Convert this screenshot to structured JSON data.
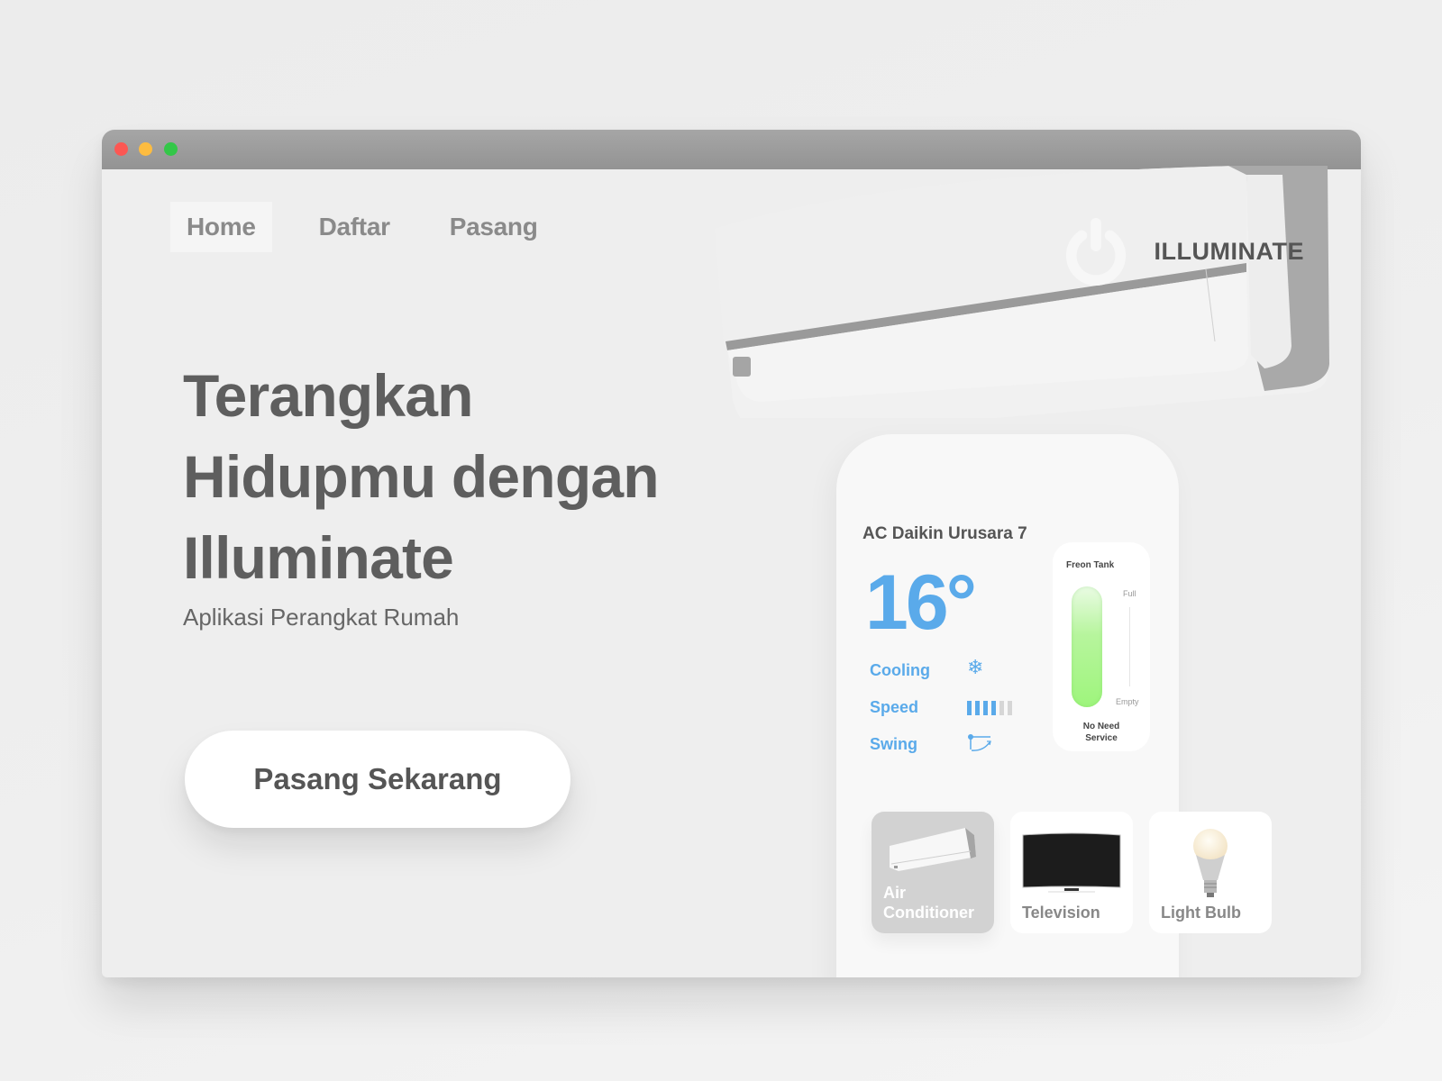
{
  "window": {
    "controls": [
      "close",
      "minimize",
      "maximize"
    ]
  },
  "nav": {
    "items": [
      {
        "label": "Home",
        "active": true
      },
      {
        "label": "Daftar",
        "active": false
      },
      {
        "label": "Pasang",
        "active": false
      }
    ]
  },
  "brand": {
    "name": "ILLUMINATE",
    "icon": "power-icon"
  },
  "hero": {
    "title_lines": [
      "Terangkan",
      "Hidupmu dengan",
      "Illuminate"
    ],
    "subtitle": "Aplikasi Perangkat Rumah",
    "cta_label": "Pasang Sekarang"
  },
  "device_panel": {
    "device_name": "AC Daikin Urusara 7",
    "temperature": "16°",
    "mode_label": "Cooling",
    "mode_icon": "snowflake-icon",
    "speed_label": "Speed",
    "speed_level": 4,
    "speed_max": 6,
    "swing_label": "Swing",
    "swing_icon": "swing-icon",
    "freon": {
      "title": "Freon Tank",
      "full_label": "Full",
      "empty_label": "Empty",
      "fill_fraction": 1.0,
      "status": "No Need Service"
    },
    "devices": [
      {
        "label": "Air Conditioner",
        "icon": "air-conditioner-icon",
        "active": true
      },
      {
        "label": "Television",
        "icon": "television-icon",
        "active": false
      },
      {
        "label": "Light Bulb",
        "icon": "light-bulb-icon",
        "active": false
      }
    ]
  },
  "colors": {
    "accent": "#5aaaea",
    "freon_fill": "#9ef57c",
    "text_dark": "#5e5e5e",
    "titlebar": "#9e9e9e"
  }
}
